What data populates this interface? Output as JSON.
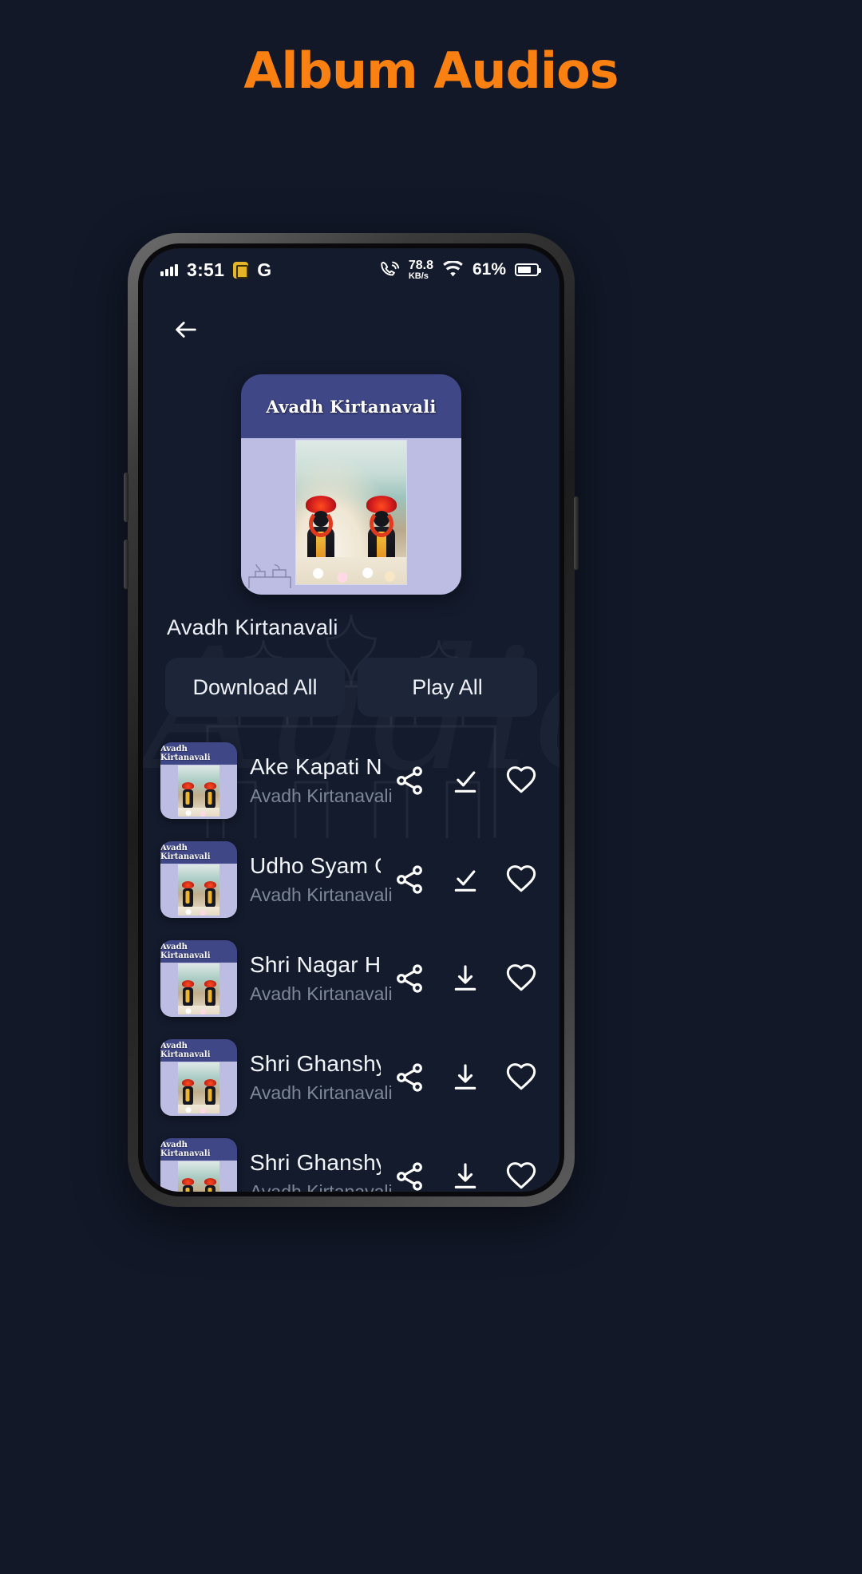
{
  "promo": {
    "headline": "Album Audios",
    "headline_color": "#fa8012"
  },
  "status_bar": {
    "time": "3:51",
    "carrier_badge_icon": "shield-badge-icon",
    "network_type": "G",
    "signal_icon": "signal-bars-icon",
    "call_wifi_icon": "wifi-calling-icon",
    "net_speed_value": "78.8",
    "net_speed_unit": "KB/s",
    "wifi_icon": "wifi-icon",
    "battery_percent": "61%"
  },
  "screen": {
    "back_icon": "back-arrow-icon",
    "cover": {
      "title": "Avadh Kirtanavali"
    },
    "album_name": "Avadh Kirtanavali",
    "buttons": {
      "download_all": "Download All",
      "play_all": "Play All"
    },
    "watermark_text": "Audio",
    "songs": [
      {
        "title": "Ake Kapati Na tare …",
        "artist": "Avadh Kirtanavali",
        "thumb_title": "Avadh Kirtanavali",
        "share_icon": "share-icon",
        "download_icon": "download-done-icon",
        "favorite_icon": "heart-icon",
        "downloaded": true
      },
      {
        "title": "Udho Syam Chabi M…",
        "artist": "Avadh Kirtanavali",
        "thumb_title": "Avadh Kirtanavali",
        "share_icon": "share-icon",
        "download_icon": "download-done-icon",
        "favorite_icon": "heart-icon",
        "downloaded": true
      },
      {
        "title": "Shri Nagar Hari Khel…",
        "artist": "Avadh Kirtanavali",
        "thumb_title": "Avadh Kirtanavali",
        "share_icon": "share-icon",
        "download_icon": "download-icon",
        "favorite_icon": "heart-icon",
        "downloaded": false
      },
      {
        "title": "Shri Ghanshyam Vai…",
        "artist": "Avadh Kirtanavali",
        "thumb_title": "Avadh Kirtanavali",
        "share_icon": "share-icon",
        "download_icon": "download-icon",
        "favorite_icon": "heart-icon",
        "downloaded": false
      },
      {
        "title": "Shri Ghanshyam shri…",
        "artist": "Avadh Kirtanavali",
        "thumb_title": "Avadh Kirtanavali",
        "share_icon": "share-icon",
        "download_icon": "download-icon",
        "favorite_icon": "heart-icon",
        "downloaded": false
      }
    ]
  },
  "colors": {
    "page_bg": "#121828",
    "screen_bg": "#141b2d",
    "accent_orange": "#fa8012",
    "cover_header": "#3f4787",
    "cover_body": "#bdbde4",
    "button_bg": "#1d2538",
    "subtitle": "#7d8797"
  }
}
